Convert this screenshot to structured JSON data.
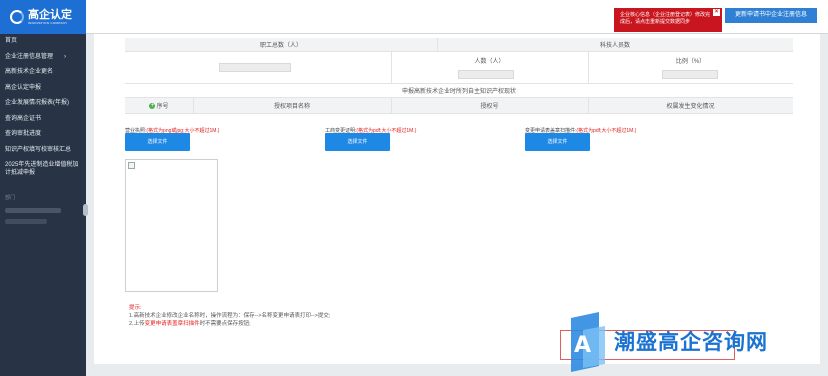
{
  "brand": {
    "title": "高企认定",
    "subtitle": "INNOVATION COMPANY"
  },
  "alert": {
    "text": "企业核心信息（企业注册登记表）修改完成后，请点击重新提交数据同步",
    "close_glyph": "×"
  },
  "top_button": "更新申请书中企业注册信息",
  "sidebar": {
    "items": [
      {
        "label": "首页"
      },
      {
        "label": "企业注册信息管理",
        "chevron": "›"
      },
      {
        "label": "高新技术企业更名"
      },
      {
        "label": "高企认定申报"
      },
      {
        "label": "企业发展情况报表(年报)"
      },
      {
        "label": "查询高企证书"
      },
      {
        "label": "查询审批进度"
      },
      {
        "label": "知识产权填写校审核汇总"
      },
      {
        "label": "2025年先进制造业增值税加计抵减申报"
      }
    ],
    "muted_label": "部门"
  },
  "table": {
    "col_employees": "职工总数（人）",
    "col_tech_staff": "科技人员数",
    "col_count": "人数（人）",
    "col_ratio": "比例（%）",
    "ip_section_title": "申报高新技术企业时所列自主知识产权现状",
    "ip_headers": {
      "index": "序号",
      "name": "授权项目名称",
      "number": "授权号",
      "change": "权属发生变化情况"
    }
  },
  "uploads": [
    {
      "label": "营业执照:",
      "hint": "(格式为png或jpg;大小不超过1M.)",
      "button": "选择文件"
    },
    {
      "label": "工商变更证明:",
      "hint": "(格式为pdf;大小不超过1M.)",
      "button": "选择文件"
    },
    {
      "label": "变更申请表盖章扫描件:",
      "hint": "(格式为pdf;大小不超过1M.)",
      "button": "选择文件"
    }
  ],
  "tips": {
    "title": "提示:",
    "line1": "1.高新技术企业修改企业名称时，操作流程为：保存-->名称变更申请表打印-->提交;",
    "line2_prefix": "2.上传",
    "line2_highlight": "变更申请表盖章扫描件",
    "line2_suffix": "时不需要点保存按钮;"
  },
  "watermark": "潮盛高企咨询网",
  "colors": {
    "brand": "#1d6fd4",
    "sidebar": "#283445",
    "alert": "#c9151e",
    "accent": "#1e88e5",
    "required": "#e02020"
  }
}
